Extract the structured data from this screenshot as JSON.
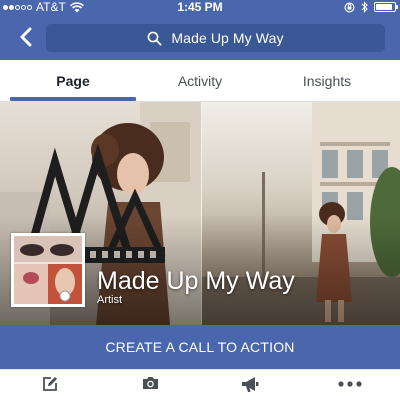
{
  "status_bar": {
    "carrier": "AT&T",
    "time": "1:45 PM",
    "battery_level": 0.9,
    "signal_bars_on": 2,
    "signal_bars_total": 5,
    "icons": [
      "wifi-icon",
      "lock-rotation-icon",
      "bluetooth-icon",
      "battery-icon"
    ]
  },
  "nav": {
    "search_text": "Made Up My Way",
    "icons": [
      "back-chevron-icon",
      "search-icon"
    ]
  },
  "tabs": [
    {
      "label": "Page",
      "active": true
    },
    {
      "label": "Activity",
      "active": false
    },
    {
      "label": "Insights",
      "active": false
    }
  ],
  "cover": {
    "page_name": "Made Up My Way",
    "category": "Artist"
  },
  "cta": {
    "label": "CREATE A CALL TO ACTION"
  },
  "actions": [
    {
      "icon": "compose-icon"
    },
    {
      "icon": "camera-icon"
    },
    {
      "icon": "megaphone-icon"
    },
    {
      "icon": "more-icon"
    }
  ],
  "colors": {
    "brand_blue": "#4a67ad",
    "search_field": "#3a5796",
    "icon_gray": "#4b4f56"
  }
}
